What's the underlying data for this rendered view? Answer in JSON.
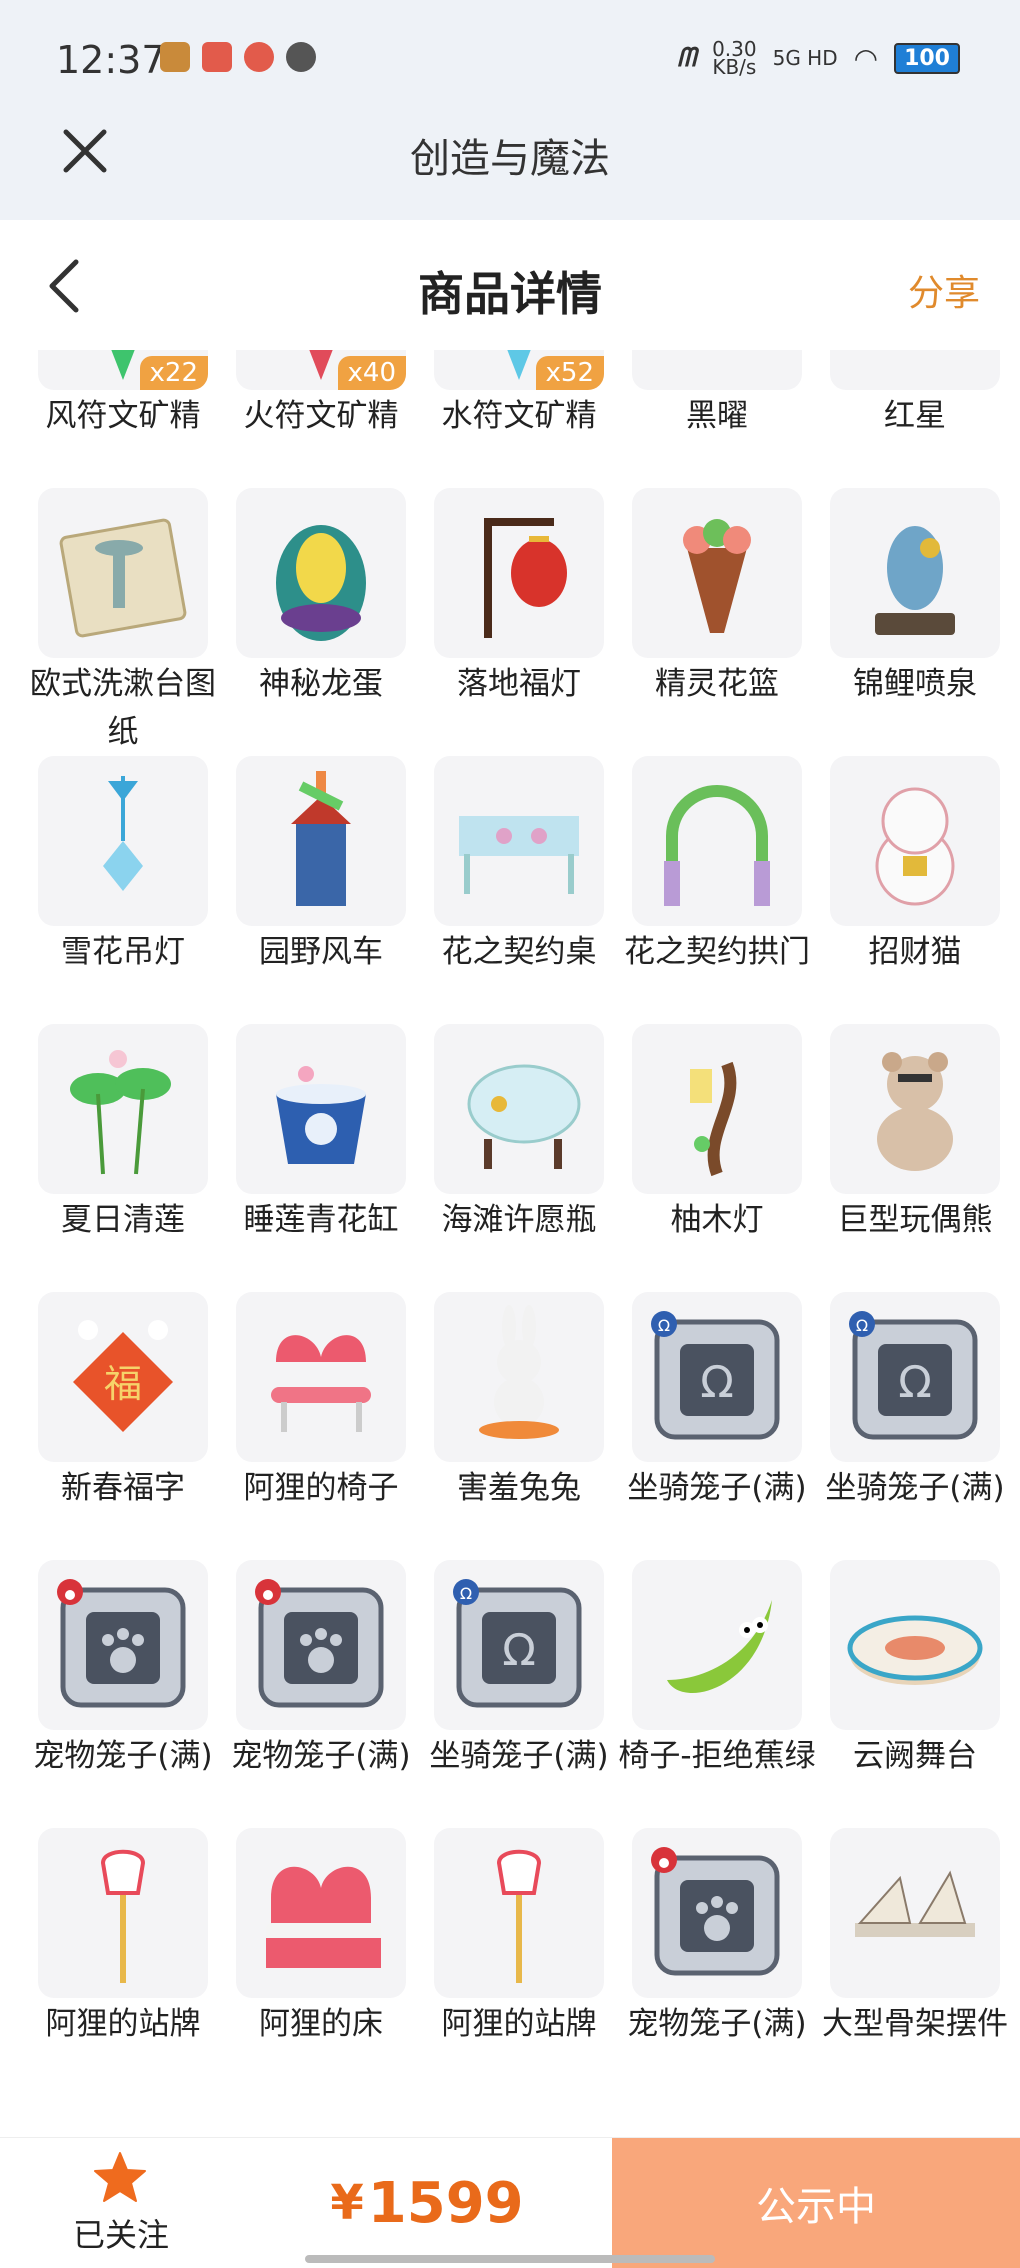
{
  "status_bar": {
    "time": "12:37",
    "net_speed": "0.30",
    "net_unit": "KB/s",
    "net_type": "5G HD",
    "battery": "100"
  },
  "app_bar": {
    "title": "创造与魔法"
  },
  "header": {
    "title": "商品详情",
    "share": "分享"
  },
  "items": [
    {
      "name": "风符文矿精",
      "qty": "x22",
      "icon": "green-crystal-icon"
    },
    {
      "name": "火符文矿精",
      "qty": "x40",
      "icon": "red-crystal-icon"
    },
    {
      "name": "水符文矿精",
      "qty": "x52",
      "icon": "blue-crystal-icon"
    },
    {
      "name": "黑曜",
      "qty": "",
      "icon": "black-vehicle-icon"
    },
    {
      "name": "红星",
      "qty": "",
      "icon": "red-motorbike-icon"
    },
    {
      "name": "欧式洗漱台图纸",
      "qty": "",
      "icon": "blueprint-icon"
    },
    {
      "name": "神秘龙蛋",
      "qty": "",
      "icon": "dragon-egg-icon"
    },
    {
      "name": "落地福灯",
      "qty": "",
      "icon": "lantern-icon"
    },
    {
      "name": "精灵花篮",
      "qty": "",
      "icon": "flower-basket-icon"
    },
    {
      "name": "锦鲤喷泉",
      "qty": "",
      "icon": "koi-fountain-icon"
    },
    {
      "name": "雪花吊灯",
      "qty": "",
      "icon": "snowflake-lamp-icon"
    },
    {
      "name": "园野风车",
      "qty": "",
      "icon": "windmill-icon"
    },
    {
      "name": "花之契约桌",
      "qty": "",
      "icon": "flower-table-icon"
    },
    {
      "name": "花之契约拱门",
      "qty": "",
      "icon": "flower-arch-icon"
    },
    {
      "name": "招财猫",
      "qty": "",
      "icon": "lucky-cat-icon"
    },
    {
      "name": "夏日清莲",
      "qty": "",
      "icon": "lotus-icon"
    },
    {
      "name": "睡莲青花缸",
      "qty": "",
      "icon": "porcelain-pot-icon"
    },
    {
      "name": "海滩许愿瓶",
      "qty": "",
      "icon": "wish-bottle-icon"
    },
    {
      "name": "柚木灯",
      "qty": "",
      "icon": "wood-lamp-icon"
    },
    {
      "name": "巨型玩偶熊",
      "qty": "",
      "icon": "teddy-bear-icon"
    },
    {
      "name": "新春福字",
      "qty": "",
      "icon": "fu-character-icon"
    },
    {
      "name": "阿狸的椅子",
      "qty": "",
      "icon": "ali-chair-icon"
    },
    {
      "name": "害羞兔兔",
      "qty": "",
      "icon": "bunny-icon"
    },
    {
      "name": "坐骑笼子(满)",
      "qty": "",
      "icon": "mount-cage-icon"
    },
    {
      "name": "坐骑笼子(满)",
      "qty": "",
      "icon": "mount-cage-icon"
    },
    {
      "name": "宠物笼子(满)",
      "qty": "",
      "icon": "pet-cage-icon"
    },
    {
      "name": "宠物笼子(满)",
      "qty": "",
      "icon": "pet-cage-icon"
    },
    {
      "name": "坐骑笼子(满)",
      "qty": "",
      "icon": "mount-cage-icon"
    },
    {
      "name": "椅子-拒绝蕉绿",
      "qty": "",
      "icon": "banana-chair-icon"
    },
    {
      "name": "云阙舞台",
      "qty": "",
      "icon": "round-stage-icon"
    },
    {
      "name": "阿狸的站牌",
      "qty": "",
      "icon": "ali-sign-icon"
    },
    {
      "name": "阿狸的床",
      "qty": "",
      "icon": "ali-bed-icon"
    },
    {
      "name": "阿狸的站牌",
      "qty": "",
      "icon": "ali-sign-icon"
    },
    {
      "name": "宠物笼子(满)",
      "qty": "",
      "icon": "pet-cage-icon"
    },
    {
      "name": "大型骨架摆件",
      "qty": "",
      "icon": "skeleton-icon"
    }
  ],
  "bottom_bar": {
    "follow_label": "已关注",
    "currency": "¥",
    "price": "1599",
    "status_label": "公示中"
  },
  "colors": {
    "accent": "#e96a1a",
    "share": "#e08a2c",
    "status_button": "#f9a77b",
    "qty_badge": "#f0a242"
  }
}
